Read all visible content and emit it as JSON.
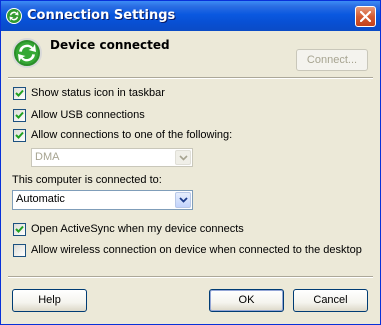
{
  "window": {
    "title": "Connection Settings"
  },
  "status": {
    "label": "Device connected",
    "connect_button": "Connect..."
  },
  "options": {
    "show_status_icon": {
      "label": "Show status icon in taskbar",
      "checked": true
    },
    "allow_usb": {
      "label": "Allow USB connections",
      "checked": true
    },
    "allow_connections_to": {
      "label": "Allow connections to one of the following:",
      "checked": true
    }
  },
  "port_select": {
    "value": "DMA",
    "enabled": false
  },
  "computer_connected": {
    "label": "This computer is connected to:",
    "value": "Automatic"
  },
  "sync_options": {
    "open_activesync": {
      "label": "Open ActiveSync when my device connects",
      "checked": true
    },
    "allow_wireless": {
      "label": "Allow wireless connection on device when connected to the desktop",
      "checked": false
    }
  },
  "footer": {
    "help": "Help",
    "ok": "OK",
    "cancel": "Cancel"
  },
  "colors": {
    "titlebar": "#0a58e0",
    "face": "#ece9d8",
    "check": "#21a121"
  }
}
